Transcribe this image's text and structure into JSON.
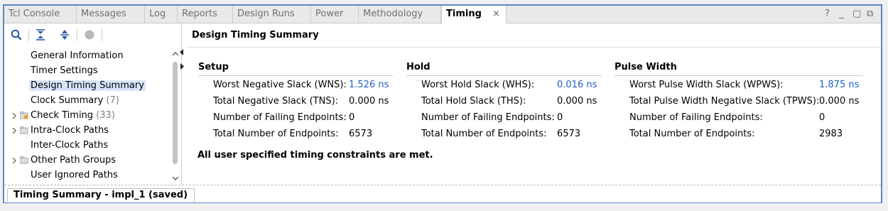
{
  "tabs": [
    {
      "label": "Tcl Console"
    },
    {
      "label": "Messages"
    },
    {
      "label": "Log"
    },
    {
      "label": "Reports"
    },
    {
      "label": "Design Runs"
    },
    {
      "label": "Power"
    },
    {
      "label": "Methodology"
    },
    {
      "label": "Timing",
      "active": true,
      "close": "×"
    }
  ],
  "window_controls": {
    "help": "?",
    "minimize": "_",
    "restore": "▢",
    "float": "⧉"
  },
  "toolbar_icons": [
    "search-icon",
    "collapse-all-icon",
    "expand-all-icon",
    "record-icon"
  ],
  "tree": [
    {
      "label": "General Information",
      "count": ""
    },
    {
      "label": "Timer Settings",
      "count": ""
    },
    {
      "label": "Design Timing Summary",
      "count": "",
      "selected": true
    },
    {
      "label": "Clock Summary",
      "count": "(7)"
    },
    {
      "label": "Check Timing",
      "count": "(33)",
      "expandable": true,
      "icon": "warning-folder-icon"
    },
    {
      "label": "Intra-Clock Paths",
      "count": "",
      "expandable": true,
      "icon": "folder-icon"
    },
    {
      "label": "Inter-Clock Paths",
      "count": ""
    },
    {
      "label": "Other Path Groups",
      "count": "",
      "expandable": true,
      "icon": "folder-icon"
    },
    {
      "label": "User Ignored Paths",
      "count": ""
    }
  ],
  "main": {
    "title": "Design Timing Summary",
    "sections": [
      {
        "title": "Setup",
        "rows": [
          {
            "label": "Worst Negative Slack (WNS):",
            "value": "1.526 ns",
            "link": true
          },
          {
            "label": "Total Negative Slack (TNS):",
            "value": "0.000 ns",
            "link": false
          },
          {
            "label": "Number of Failing Endpoints:",
            "value": "0",
            "link": false
          },
          {
            "label": "Total Number of Endpoints:",
            "value": "6573",
            "link": false
          }
        ]
      },
      {
        "title": "Hold",
        "rows": [
          {
            "label": "Worst Hold Slack (WHS):",
            "value": "0.016 ns",
            "link": true
          },
          {
            "label": "Total Hold Slack (THS):",
            "value": "0.000 ns",
            "link": false
          },
          {
            "label": "Number of Failing Endpoints:",
            "value": "0",
            "link": false
          },
          {
            "label": "Total Number of Endpoints:",
            "value": "6573",
            "link": false
          }
        ]
      },
      {
        "title": "Pulse Width",
        "rows": [
          {
            "label": "Worst Pulse Width Slack (WPWS):",
            "value": "1.875 ns",
            "link": true
          },
          {
            "label": "Total Pulse Width Negative Slack (TPWS):",
            "value": "0.000 ns",
            "link": false
          },
          {
            "label": "Number of Failing Endpoints:",
            "value": "0",
            "link": false
          },
          {
            "label": "Total Number of Endpoints:",
            "value": "2983",
            "link": false
          }
        ]
      }
    ],
    "status_message": "All user specified timing constraints are met."
  },
  "status_tab": {
    "label": "Timing Summary - impl_1 (saved)"
  },
  "colors": {
    "accent_border": "#5c87c7",
    "link": "#1f5fc4",
    "selection": "#d8e6fa"
  }
}
